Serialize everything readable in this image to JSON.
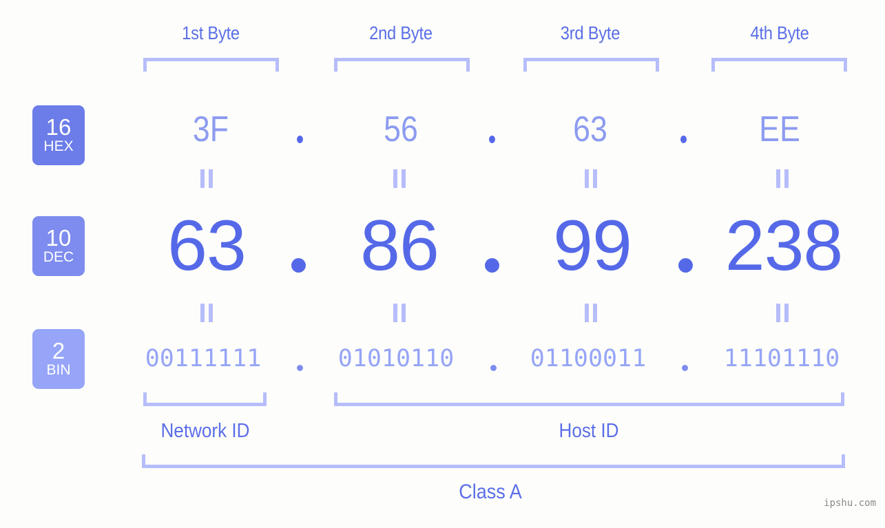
{
  "meta": {
    "background_color": "#fdfefb",
    "accent_strong": "#5569e8",
    "accent_mid": "#8d9bf0",
    "accent_light": "#b6bdfb",
    "watermark": "ipshu.com"
  },
  "byte_headers": [
    {
      "label": "1st Byte"
    },
    {
      "label": "2nd Byte"
    },
    {
      "label": "3rd Byte"
    },
    {
      "label": "4th Byte"
    }
  ],
  "rows": {
    "hex": {
      "badge_number": "16",
      "badge_name": "HEX",
      "badge_color": "#6c7ce8",
      "values": [
        "3F",
        "56",
        "63",
        "EE"
      ],
      "separator": "."
    },
    "dec": {
      "badge_number": "10",
      "badge_name": "DEC",
      "badge_color": "#7d8cee",
      "values": [
        "63",
        "86",
        "99",
        "238"
      ],
      "separator": "."
    },
    "bin": {
      "badge_number": "2",
      "badge_name": "BIN",
      "badge_color": "#96a5f7",
      "values": [
        "00111111",
        "01010110",
        "01100011",
        "11101110"
      ],
      "separator": "."
    }
  },
  "equals_marker": "=",
  "id_sections": [
    {
      "label": "Network ID"
    },
    {
      "label": "Host ID"
    }
  ],
  "class_label": "Class A",
  "address": {
    "hex": "3F.56.63.EE",
    "dec": "63.86.99.238",
    "bin": "00111111.01010110.01100011.11101110"
  }
}
